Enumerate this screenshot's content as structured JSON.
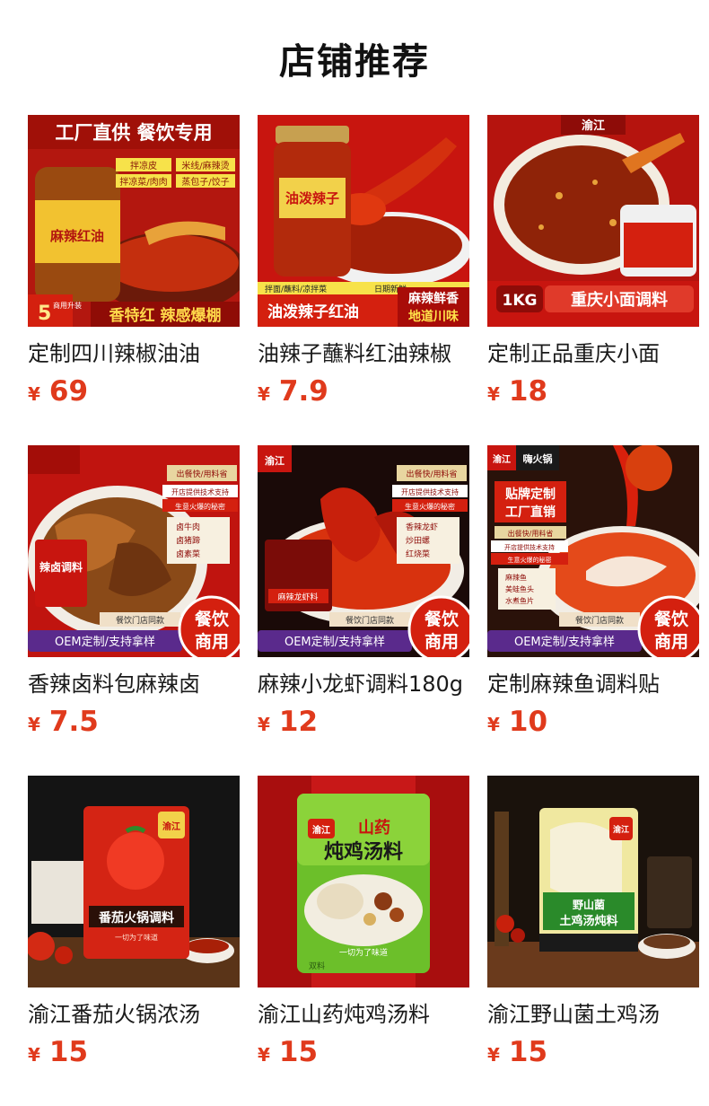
{
  "header": {
    "title": "店铺推荐"
  },
  "currency": "¥",
  "products": [
    {
      "name": "定制四川辣椒油油",
      "price": "69",
      "image": {
        "icon": "chili-oil-bottle-image",
        "texts": [
          "工厂直供 餐饮专用",
          "拌凉皮",
          "米线/麻辣烫",
          "拌凉菜/肉肉",
          "蒸包子/饺子",
          "麻辣红油",
          "5",
          "商用升装",
          "香特红 辣感爆棚"
        ]
      }
    },
    {
      "name": "油辣子蘸料红油辣椒",
      "price": "7.9",
      "image": {
        "icon": "chili-jar-spoon-image",
        "texts": [
          "油泼辣子",
          "拌面/蘸料/凉拌菜",
          "日期新鲜",
          "麻辣鲜香",
          "地道川味",
          "油泼辣子红油"
        ]
      }
    },
    {
      "name": "定制正品重庆小面",
      "price": "18",
      "image": {
        "icon": "noodle-sauce-bucket-image",
        "texts": [
          "渝江",
          "1KG",
          "重庆小面调料"
        ]
      }
    },
    {
      "name": "香辣卤料包麻辣卤",
      "price": "7.5",
      "image": {
        "icon": "braised-meat-image",
        "texts": [
          "出餐快/用料省",
          "开店提供技术支持",
          "生意火爆的秘密",
          "卤牛肉",
          "卤猪蹄",
          "卤素菜",
          "辣卤调料",
          "餐饮门店同款",
          "OEM定制/支持拿样",
          "餐饮",
          "商用"
        ]
      }
    },
    {
      "name": "麻辣小龙虾调料180g",
      "price": "12",
      "image": {
        "icon": "crayfish-image",
        "texts": [
          "渝江",
          "出餐快/用料省",
          "开店提供技术支持",
          "生意火爆的秘密",
          "香辣龙虾",
          "炒田螺",
          "红烧菜",
          "麻辣龙虾料",
          "餐饮门店同款",
          "OEM定制/支持拿样",
          "餐饮",
          "商用"
        ]
      }
    },
    {
      "name": "定制麻辣鱼调料贴",
      "price": "10",
      "image": {
        "icon": "spicy-fish-image",
        "texts": [
          "渝江",
          "嗨火锅",
          "贴牌定制",
          "工厂直销",
          "出餐快/用料省",
          "开店提供技术支持",
          "生意火爆的秘密",
          "麻辣鱼",
          "美蛙鱼头",
          "水煮鱼片",
          "餐饮门店同款",
          "OEM定制/支持拿样",
          "餐饮",
          "商用"
        ]
      }
    },
    {
      "name": "渝江番茄火锅浓汤",
      "price": "15",
      "image": {
        "icon": "tomato-hotpot-pack-image",
        "texts": [
          "渝江",
          "番茄火锅调料",
          "一切为了味道"
        ]
      }
    },
    {
      "name": "渝江山药炖鸡汤料",
      "price": "15",
      "image": {
        "icon": "yam-chicken-soup-pack-image",
        "texts": [
          "渝江",
          "山药",
          "炖鸡汤料",
          "一切为了味道",
          "双料"
        ]
      }
    },
    {
      "name": "渝江野山菌土鸡汤",
      "price": "15",
      "image": {
        "icon": "mushroom-chicken-soup-pack-image",
        "texts": [
          "渝江",
          "野山菌",
          "土鸡汤炖料"
        ]
      }
    }
  ]
}
